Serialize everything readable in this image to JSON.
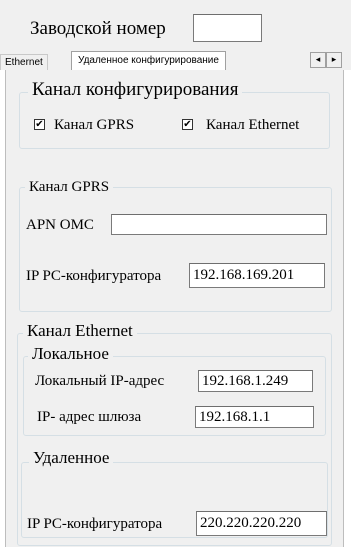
{
  "header": {
    "serial_label": "Заводской номер",
    "serial_value": ""
  },
  "tabs": [
    {
      "label": "Ethernet",
      "active": false
    },
    {
      "label": "Удаленное конфигурирование",
      "active": true
    }
  ],
  "icons": {
    "scroll_left": "◂",
    "scroll_right": "▸",
    "check": "✔"
  },
  "config_channel": {
    "title": "Канал конфигурирования",
    "gprs_label": "Канал GPRS",
    "gprs_checked": true,
    "ethernet_label": "Канал Ethernet",
    "ethernet_checked": true
  },
  "gprs_channel": {
    "title": "Канал GPRS",
    "apn_label": "APN OMC",
    "apn_value": "",
    "ip_label": "IP PC-конфигуратора",
    "ip_value": "192.168.169.201"
  },
  "ethernet_channel": {
    "title": "Канал Ethernet",
    "local": {
      "title": "Локальное",
      "local_ip_label": "Локальный IP-адрес",
      "local_ip_value": "192.168.1.249",
      "gateway_label": "IP- адрес шлюза",
      "gateway_value": "192.168.1.1"
    },
    "remote": {
      "title": "Удаленное",
      "ip_label": "IP PC-конфигуратора",
      "ip_value": "220.220.220.220"
    }
  }
}
